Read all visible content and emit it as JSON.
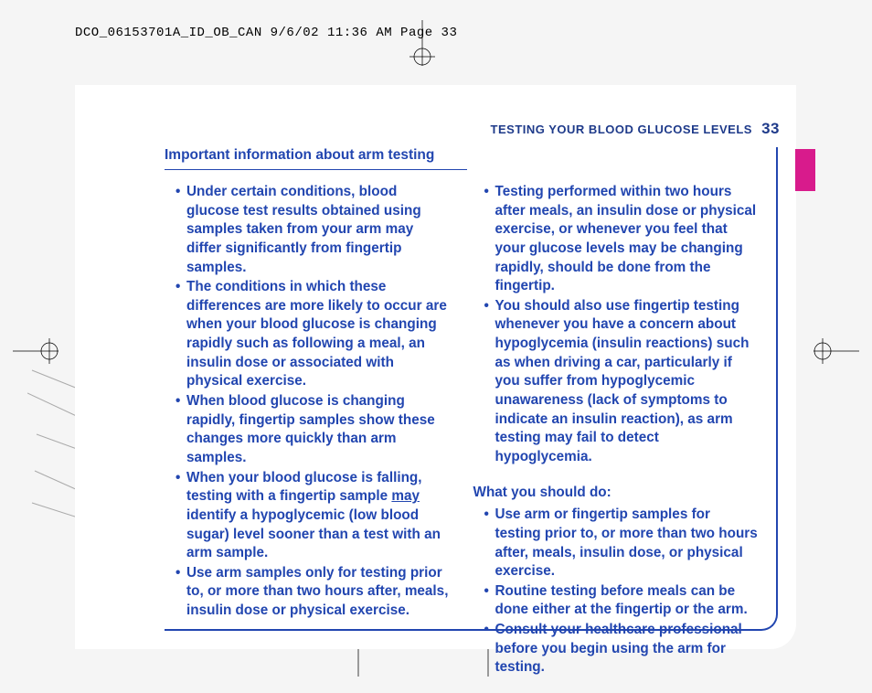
{
  "header_crop": "DCO_06153701A_ID_OB_CAN  9/6/02  11:36 AM  Page 33",
  "running_header": "TESTING YOUR BLOOD GLUCOSE LEVELS",
  "page_number": "33",
  "section_title": "Important information about arm testing",
  "left_bullets": [
    "Under certain conditions, blood glucose test results obtained using samples taken from your arm may differ significantly from fingertip samples.",
    "The conditions in which these differences are more likely to occur are when your blood glucose is changing rapidly such as following a meal, an insulin dose or associated with physical exercise.",
    "When blood glucose is changing rapidly, fingertip samples show these changes more quickly than arm samples.",
    "When your blood glucose is falling, testing with a fingertip sample ",
    " identify a hypoglycemic (low blood sugar) level sooner than a test with an arm sample.",
    "Use arm samples only for testing prior to, or more than two hours after, meals, insulin dose or physical exercise."
  ],
  "may_word": "may",
  "right_bullets_top": [
    "Testing performed within two hours after meals, an insulin dose or physical exercise, or whenever you feel that your glucose levels may be changing rapidly, should be done from the fingertip.",
    "You should also use fingertip testing whenever you have a concern about hypoglycemia (insulin reactions) such as when driving a car, particularly if you suffer from hypoglycemic unawareness (lack of symptoms to indicate an insulin reaction), as arm testing may fail to detect hypoglycemia."
  ],
  "subheading": "What you should do:",
  "right_bullets_bottom": [
    "Use arm or fingertip samples for testing prior to, or more than two hours after, meals, insulin dose, or physical exercise.",
    "Routine testing before meals can be done either at the fingertip or the arm.",
    "Consult your healthcare professional before you begin using the arm for testing."
  ]
}
